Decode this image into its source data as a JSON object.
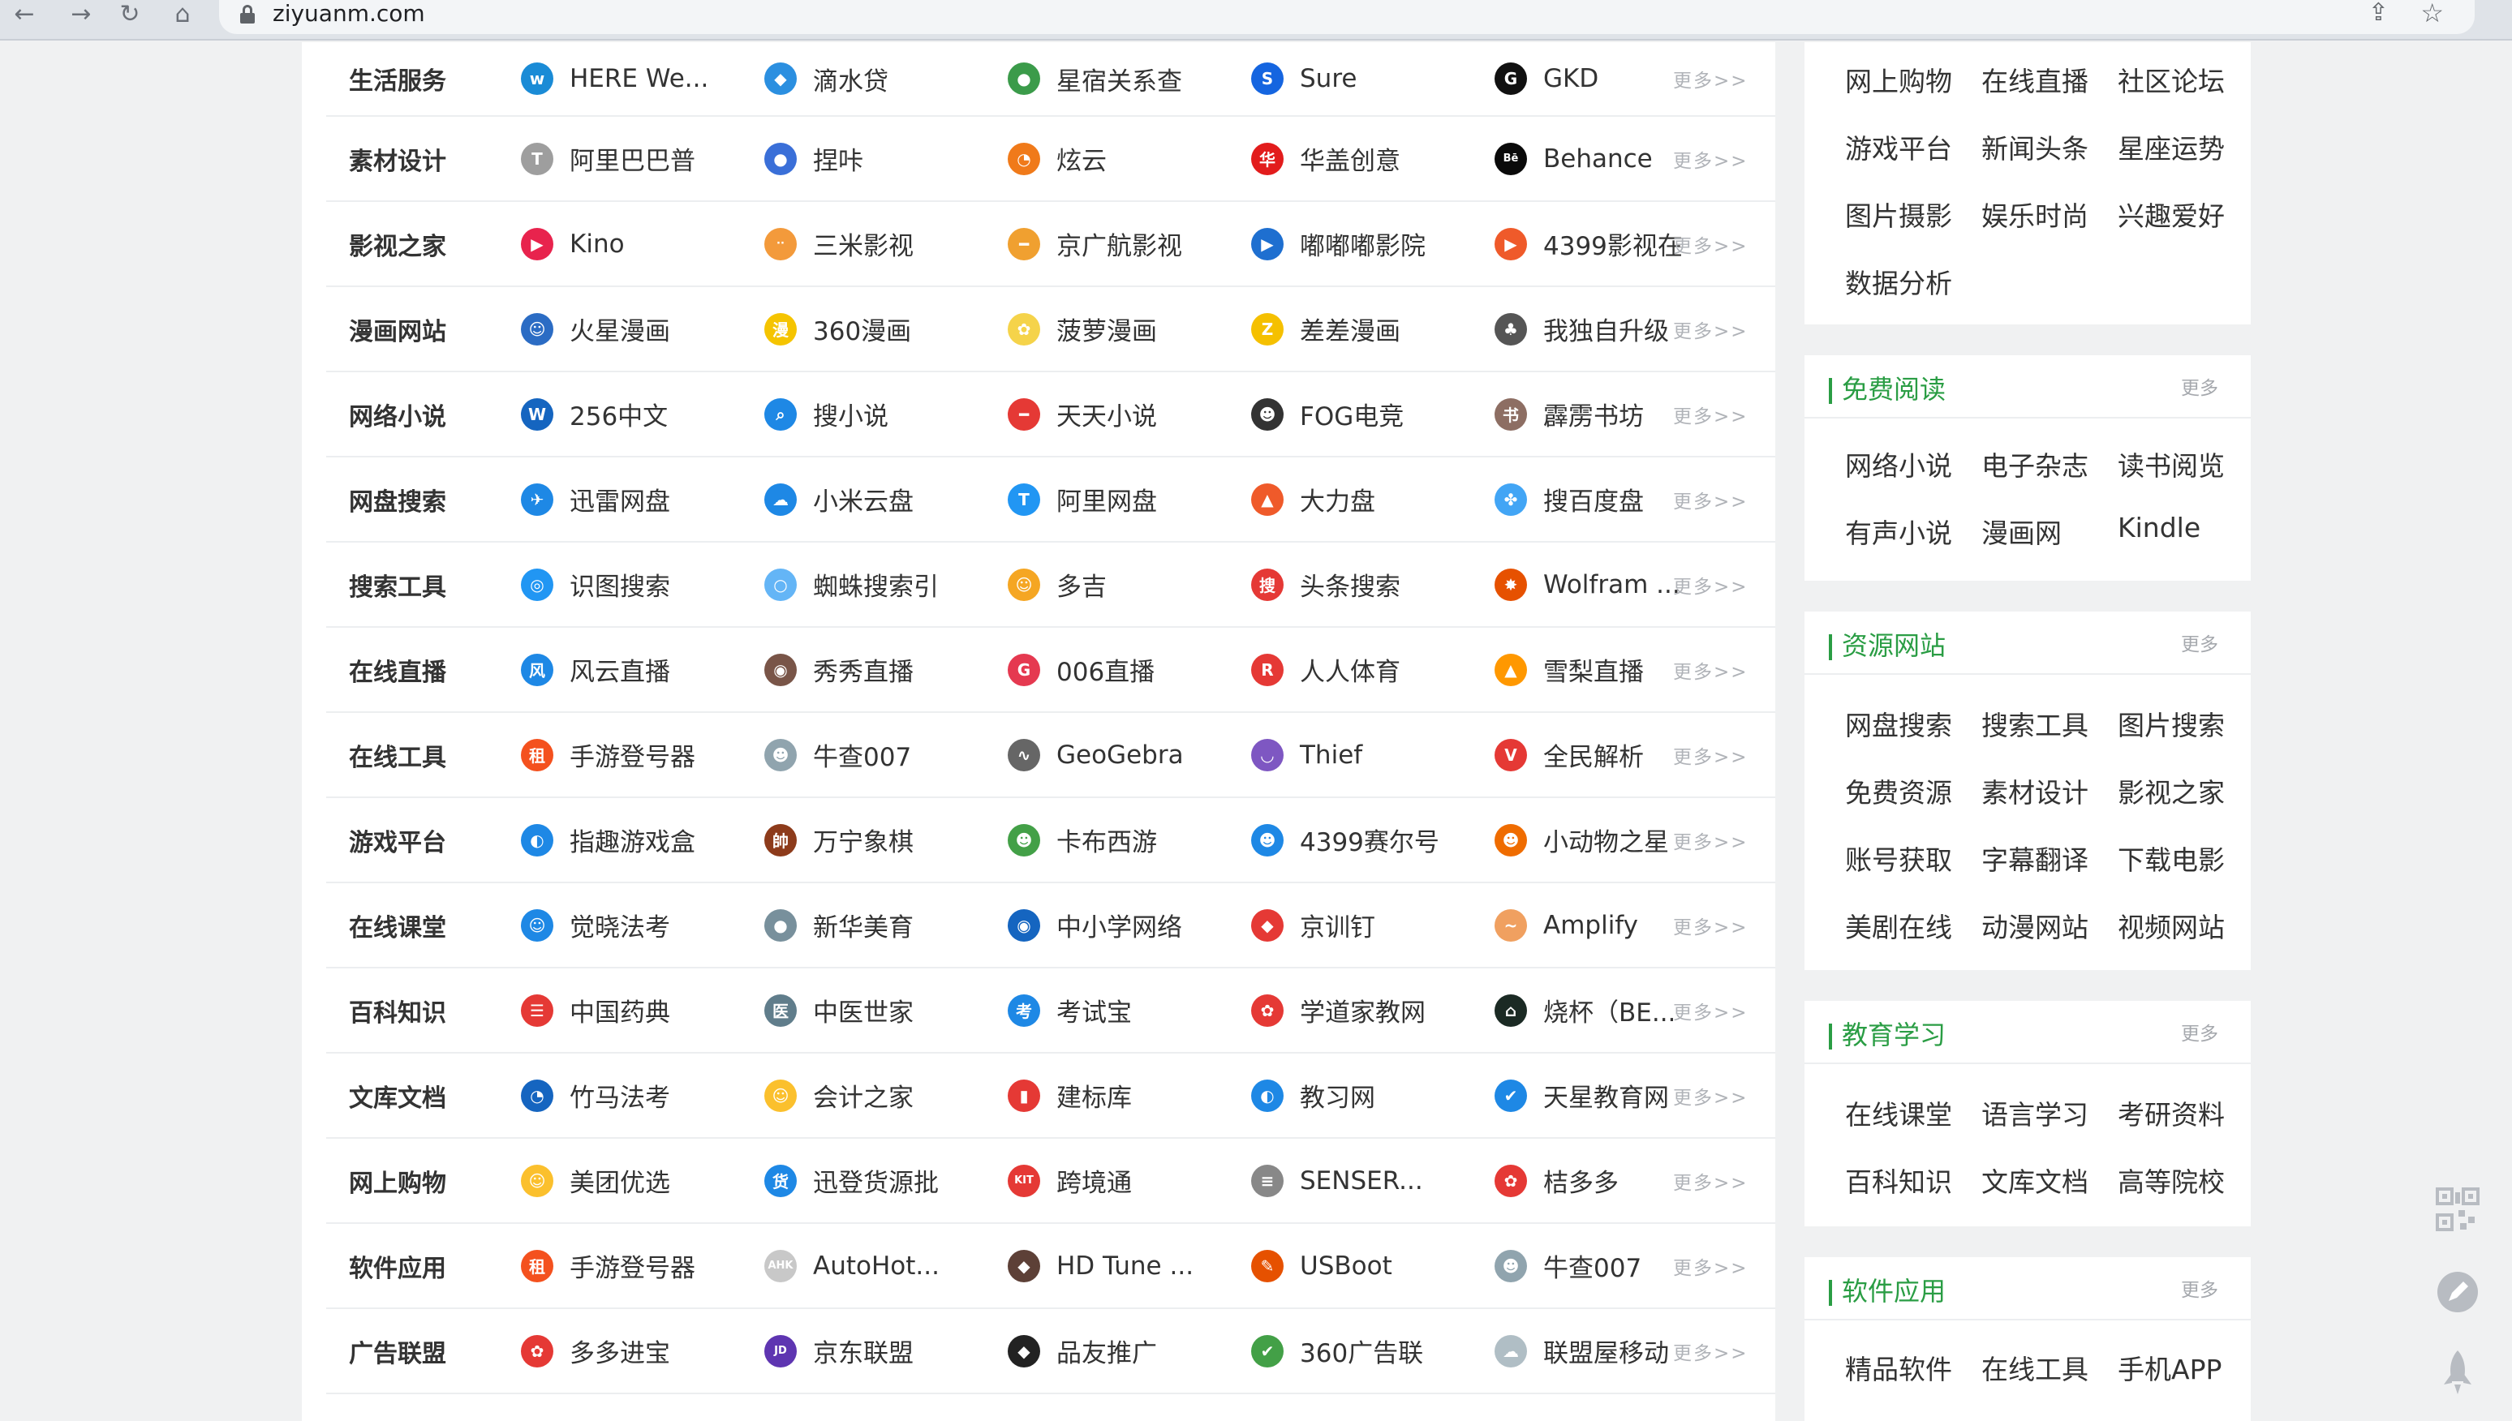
{
  "browser": {
    "url": "ziyuanm.com",
    "back": "←",
    "forward": "→",
    "reload": "↻",
    "home": "⌂",
    "share": "⇪",
    "star": "☆"
  },
  "more_label": "更多>>",
  "categories": [
    {
      "name": "生活服务",
      "sites": [
        {
          "label": "HERE We...",
          "icon": "here-icon",
          "glyph": "w",
          "color": "#1a8bd6"
        },
        {
          "label": "滴水贷",
          "icon": "drop-icon",
          "glyph": "◆",
          "color": "#2b8fe0"
        },
        {
          "label": "星宿关系查",
          "icon": "star-relation-icon",
          "glyph": "●",
          "color": "#3b9b4a"
        },
        {
          "label": "Sure",
          "icon": "sure-icon",
          "glyph": "S",
          "color": "#1565e0"
        },
        {
          "label": "GKD",
          "icon": "gkd-icon",
          "glyph": "G",
          "color": "#111111"
        }
      ]
    },
    {
      "name": "素材设计",
      "sites": [
        {
          "label": "阿里巴巴普",
          "icon": "alibaba-font-icon",
          "glyph": "T",
          "color": "#9e9e9e"
        },
        {
          "label": "捏咔",
          "icon": "nieka-icon",
          "glyph": "●",
          "color": "#3a6fd8"
        },
        {
          "label": "炫云",
          "icon": "xuanyun-icon",
          "glyph": "◔",
          "color": "#f07a1a"
        },
        {
          "label": "华盖创意",
          "icon": "huagai-icon",
          "glyph": "华",
          "color": "#e21c1c"
        },
        {
          "label": "Behance",
          "icon": "behance-icon",
          "glyph": "Bē",
          "color": "#0a0a0a"
        }
      ]
    },
    {
      "name": "影视之家",
      "sites": [
        {
          "label": "Kino",
          "icon": "kino-icon",
          "glyph": "▶",
          "color": "#e8234d"
        },
        {
          "label": "三米影视",
          "icon": "sanmi-icon",
          "glyph": "··",
          "color": "#f39a3b"
        },
        {
          "label": "京广航影视",
          "icon": "jingguang-icon",
          "glyph": "━",
          "color": "#f0a030"
        },
        {
          "label": "嘟嘟嘟影院",
          "icon": "dudu-icon",
          "glyph": "▶",
          "color": "#1e6fd0"
        },
        {
          "label": "4399影视在",
          "icon": "4399-video-icon",
          "glyph": "▶",
          "color": "#ef5a2a"
        }
      ]
    },
    {
      "name": "漫画网站",
      "sites": [
        {
          "label": "火星漫画",
          "icon": "huoxing-icon",
          "glyph": "☺",
          "color": "#2b6cc4"
        },
        {
          "label": "360漫画",
          "icon": "360-comic-icon",
          "glyph": "漫",
          "color": "#f5c400"
        },
        {
          "label": "菠萝漫画",
          "icon": "boluo-icon",
          "glyph": "✿",
          "color": "#f5d34a"
        },
        {
          "label": "差差漫画",
          "icon": "chacha-icon",
          "glyph": "Z",
          "color": "#f5c000"
        },
        {
          "label": "我独自升级",
          "icon": "solo-level-icon",
          "glyph": "♣",
          "color": "#555555"
        }
      ]
    },
    {
      "name": "网络小说",
      "sites": [
        {
          "label": "256中文",
          "icon": "256-icon",
          "glyph": "W",
          "color": "#1565c0"
        },
        {
          "label": "搜小说",
          "icon": "souxiaoshuo-icon",
          "glyph": "⌕",
          "color": "#1e88e5"
        },
        {
          "label": "天天小说",
          "icon": "tiantian-icon",
          "glyph": "━",
          "color": "#e53935"
        },
        {
          "label": "FOG电竞",
          "icon": "fog-icon",
          "glyph": "☻",
          "color": "#333333"
        },
        {
          "label": "霹雳书坊",
          "icon": "pili-icon",
          "glyph": "书",
          "color": "#8d6e63"
        }
      ]
    },
    {
      "name": "网盘搜索",
      "sites": [
        {
          "label": "迅雷网盘",
          "icon": "xunlei-icon",
          "glyph": "✈",
          "color": "#1e88e5"
        },
        {
          "label": "小米云盘",
          "icon": "mi-cloud-icon",
          "glyph": "☁",
          "color": "#1e88e5"
        },
        {
          "label": "阿里网盘",
          "icon": "aliyun-drive-icon",
          "glyph": "T",
          "color": "#2196f3"
        },
        {
          "label": "大力盘",
          "icon": "dali-icon",
          "glyph": "▲",
          "color": "#ef5a2a"
        },
        {
          "label": "搜百度盘",
          "icon": "sobaidu-icon",
          "glyph": "✤",
          "color": "#42a5f5"
        }
      ]
    },
    {
      "name": "搜索工具",
      "sites": [
        {
          "label": "识图搜索",
          "icon": "image-search-icon",
          "glyph": "◎",
          "color": "#2196f3"
        },
        {
          "label": "蜘蛛搜索引",
          "icon": "spider-search-icon",
          "glyph": "○",
          "color": "#64b5f6"
        },
        {
          "label": "多吉",
          "icon": "duoji-icon",
          "glyph": "☺",
          "color": "#f5a623"
        },
        {
          "label": "头条搜索",
          "icon": "toutiao-search-icon",
          "glyph": "搜",
          "color": "#e53935"
        },
        {
          "label": "Wolfram ...",
          "icon": "wolfram-icon",
          "glyph": "✸",
          "color": "#e65100"
        }
      ]
    },
    {
      "name": "在线直播",
      "sites": [
        {
          "label": "风云直播",
          "icon": "fengyun-icon",
          "glyph": "风",
          "color": "#1e88e5"
        },
        {
          "label": "秀秀直播",
          "icon": "xiuxiu-icon",
          "glyph": "◉",
          "color": "#795548"
        },
        {
          "label": "006直播",
          "icon": "006-icon",
          "glyph": "G",
          "color": "#e53950"
        },
        {
          "label": "人人体育",
          "icon": "renren-icon",
          "glyph": "R",
          "color": "#e53935"
        },
        {
          "label": "雪梨直播",
          "icon": "xueli-icon",
          "glyph": "▲",
          "color": "#ff9800"
        }
      ]
    },
    {
      "name": "在线工具",
      "sites": [
        {
          "label": "手游登号器",
          "icon": "login-tool-icon",
          "glyph": "租",
          "color": "#f4511e"
        },
        {
          "label": "牛查007",
          "icon": "niucha-icon",
          "glyph": "☻",
          "color": "#90a4ae"
        },
        {
          "label": "GeoGebra",
          "icon": "geogebra-icon",
          "glyph": "∿",
          "color": "#666666"
        },
        {
          "label": "Thief",
          "icon": "thief-icon",
          "glyph": "◡",
          "color": "#7e57c2"
        },
        {
          "label": "全民解析",
          "icon": "quanmin-icon",
          "glyph": "V",
          "color": "#e53935"
        }
      ]
    },
    {
      "name": "游戏平台",
      "sites": [
        {
          "label": "指趣游戏盒",
          "icon": "zhiqu-icon",
          "glyph": "◐",
          "color": "#1e88e5"
        },
        {
          "label": "万宁象棋",
          "icon": "wanning-chess-icon",
          "glyph": "帥",
          "color": "#8d3b1b"
        },
        {
          "label": "卡布西游",
          "icon": "kabu-icon",
          "glyph": "☻",
          "color": "#43a047"
        },
        {
          "label": "4399赛尔号",
          "icon": "seer-icon",
          "glyph": "☻",
          "color": "#1e88e5"
        },
        {
          "label": "小动物之星",
          "icon": "animal-star-icon",
          "glyph": "☻",
          "color": "#ef6c00"
        }
      ]
    },
    {
      "name": "在线课堂",
      "sites": [
        {
          "label": "觉晓法考",
          "icon": "juexiao-icon",
          "glyph": "☺",
          "color": "#1e88e5"
        },
        {
          "label": "新华美育",
          "icon": "xinhua-icon",
          "glyph": "●",
          "color": "#78909c"
        },
        {
          "label": "中小学网络",
          "icon": "zhongxiaoxue-icon",
          "glyph": "◉",
          "color": "#1565c0"
        },
        {
          "label": "京训钉",
          "icon": "jingxunding-icon",
          "glyph": "◆",
          "color": "#e53935"
        },
        {
          "label": "Amplify",
          "icon": "amplify-icon",
          "glyph": "~",
          "color": "#f0a060"
        }
      ]
    },
    {
      "name": "百科知识",
      "sites": [
        {
          "label": "中国药典",
          "icon": "pharmacopoeia-icon",
          "glyph": "☰",
          "color": "#e53935"
        },
        {
          "label": "中医世家",
          "icon": "zhongyi-icon",
          "glyph": "医",
          "color": "#607d8b"
        },
        {
          "label": "考试宝",
          "icon": "kaoshibao-icon",
          "glyph": "考",
          "color": "#1e88e5"
        },
        {
          "label": "学道家教网",
          "icon": "xuedao-icon",
          "glyph": "✿",
          "color": "#e53935"
        },
        {
          "label": "烧杯（BE...",
          "icon": "beaker-icon",
          "glyph": "⌂",
          "color": "#1b2a24"
        }
      ]
    },
    {
      "name": "文库文档",
      "sites": [
        {
          "label": "竹马法考",
          "icon": "zhuma-icon",
          "glyph": "◔",
          "color": "#1565c0"
        },
        {
          "label": "会计之家",
          "icon": "kuaiji-icon",
          "glyph": "☺",
          "color": "#fbc02d"
        },
        {
          "label": "建标库",
          "icon": "jianbiao-icon",
          "glyph": "▮",
          "color": "#e53935"
        },
        {
          "label": "教习网",
          "icon": "jiaoxi-icon",
          "glyph": "◐",
          "color": "#1e88e5"
        },
        {
          "label": "天星教育网",
          "icon": "tianxing-icon",
          "glyph": "✔",
          "color": "#1e88e5"
        }
      ]
    },
    {
      "name": "网上购物",
      "sites": [
        {
          "label": "美团优选",
          "icon": "meituan-icon",
          "glyph": "☺",
          "color": "#fbc02d"
        },
        {
          "label": "迅登货源批",
          "icon": "xundeng-icon",
          "glyph": "货",
          "color": "#1e88e5"
        },
        {
          "label": "跨境通",
          "icon": "kuajing-icon",
          "glyph": "KIT",
          "color": "#e53935"
        },
        {
          "label": "SENSER...",
          "icon": "senser-icon",
          "glyph": "≡",
          "color": "#888888"
        },
        {
          "label": "桔多多",
          "icon": "juduoduo-icon",
          "glyph": "✿",
          "color": "#e53935"
        }
      ]
    },
    {
      "name": "软件应用",
      "sites": [
        {
          "label": "手游登号器",
          "icon": "login-tool-icon",
          "glyph": "租",
          "color": "#f4511e"
        },
        {
          "label": "AutoHot...",
          "icon": "autohotkey-icon",
          "glyph": "AHK",
          "color": "#c8c8c8"
        },
        {
          "label": "HD Tune ...",
          "icon": "hdtune-icon",
          "glyph": "◆",
          "color": "#5d4037"
        },
        {
          "label": "USBoot",
          "icon": "usboot-icon",
          "glyph": "✎",
          "color": "#e65100"
        },
        {
          "label": "牛查007",
          "icon": "niucha-icon",
          "glyph": "☻",
          "color": "#90a4ae"
        }
      ]
    },
    {
      "name": "广告联盟",
      "sites": [
        {
          "label": "多多进宝",
          "icon": "duoduo-icon",
          "glyph": "✿",
          "color": "#e53935"
        },
        {
          "label": "京东联盟",
          "icon": "jd-union-icon",
          "glyph": "JD",
          "color": "#5e35b1"
        },
        {
          "label": "品友推广",
          "icon": "pinyou-icon",
          "glyph": "◆",
          "color": "#222222"
        },
        {
          "label": "360广告联",
          "icon": "360-ad-icon",
          "glyph": "✔",
          "color": "#43a047"
        },
        {
          "label": "联盟屋移动",
          "icon": "lianmengwu-icon",
          "glyph": "☁",
          "color": "#b0bec5"
        }
      ]
    }
  ],
  "sidebar": {
    "top_card": {
      "links": [
        "网上购物",
        "在线直播",
        "社区论坛",
        "游戏平台",
        "新闻头条",
        "星座运势",
        "图片摄影",
        "娱乐时尚",
        "兴趣爱好",
        "数据分析"
      ]
    },
    "reading": {
      "title": "免费阅读",
      "more": "更多",
      "links": [
        "网络小说",
        "电子杂志",
        "读书阅览",
        "有声小说",
        "漫画网",
        "Kindle"
      ]
    },
    "resources": {
      "title": "资源网站",
      "more": "更多",
      "links": [
        "网盘搜索",
        "搜索工具",
        "图片搜索",
        "免费资源",
        "素材设计",
        "影视之家",
        "账号获取",
        "字幕翻译",
        "下载电影",
        "美剧在线",
        "动漫网站",
        "视频网站"
      ]
    },
    "education": {
      "title": "教育学习",
      "more": "更多",
      "links": [
        "在线课堂",
        "语言学习",
        "考研资料",
        "百科知识",
        "文库文档",
        "高等院校"
      ]
    },
    "software": {
      "title": "软件应用",
      "more": "更多",
      "links": [
        "精品软件",
        "在线工具",
        "手机APP"
      ]
    }
  },
  "float_tools": {
    "qr": "qr-code-icon",
    "edit": "edit-icon",
    "rocket": "rocket-icon"
  }
}
